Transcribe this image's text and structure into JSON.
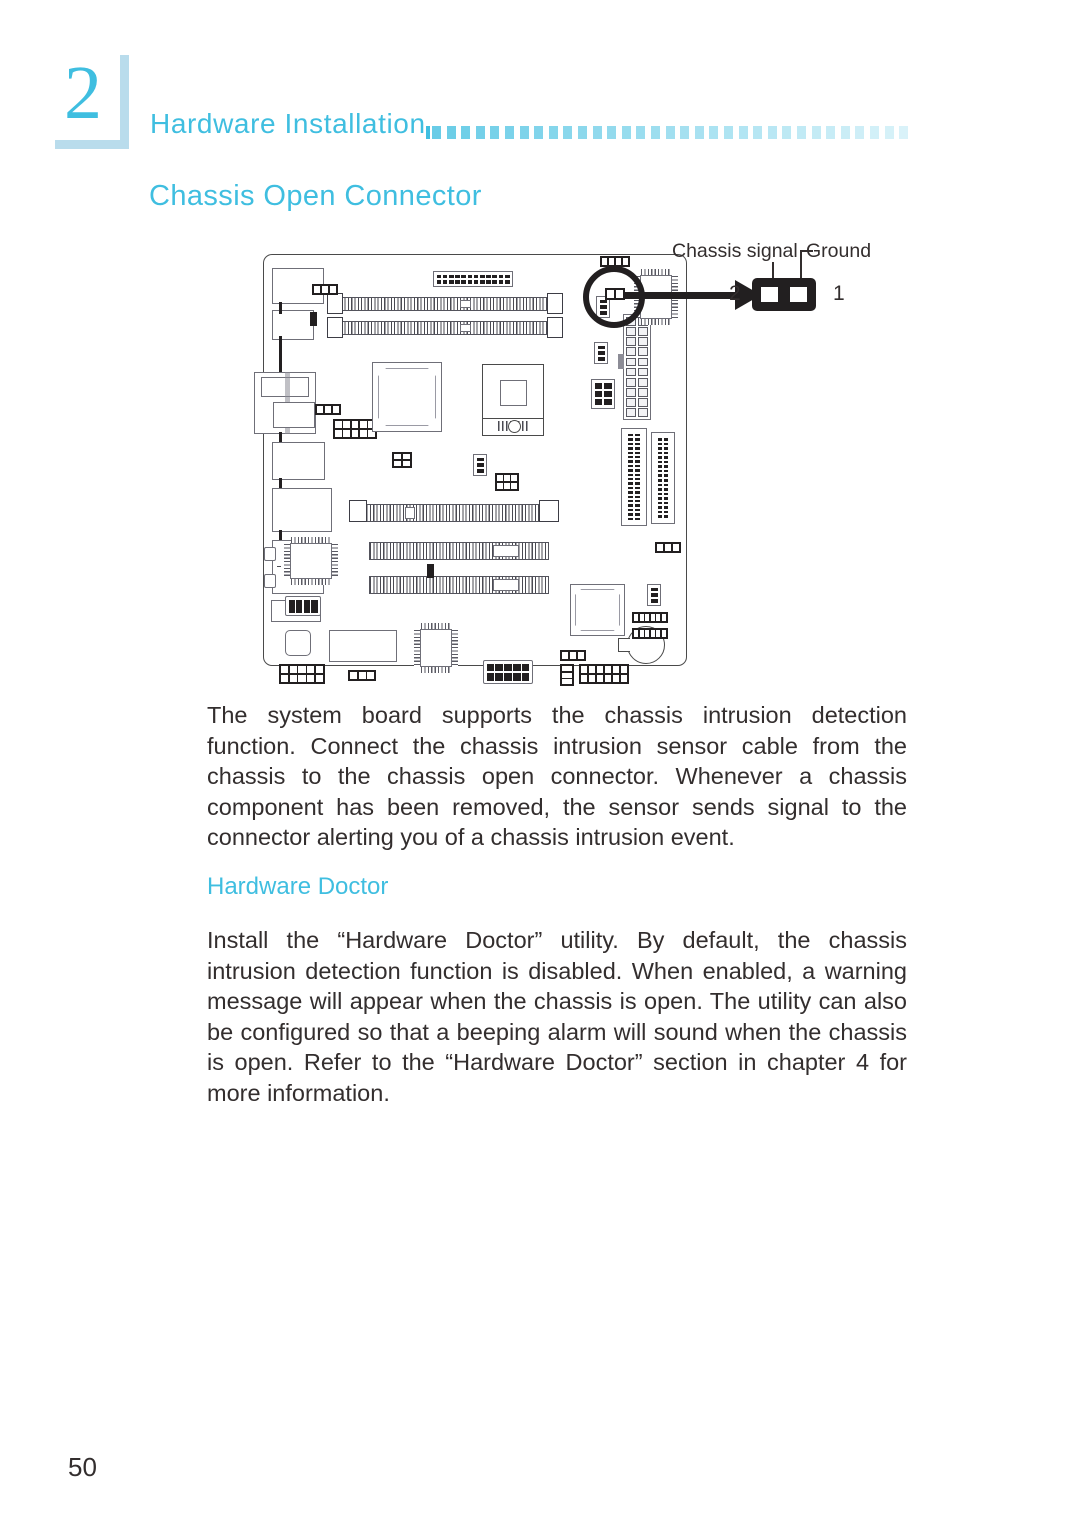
{
  "chapter": {
    "number": "2",
    "running_head": "Hardware  Installation",
    "accent_color": "#3fbee0",
    "shadow_color": "#b9dcec"
  },
  "section": {
    "title": "Chassis Open Connector"
  },
  "figure": {
    "labels": {
      "chassis_signal": "Chassis  signal",
      "ground": "Ground",
      "pin_left": "2",
      "pin_right": "1"
    },
    "caption": "",
    "board_description": "system board layout diagram with chassis open connector highlighted"
  },
  "body": {
    "paragraph_1": "The system board supports the chassis intrusion detection function. Connect the chassis intrusion sensor cable from the chassis to the chassis open connector. Whenever a chassis component has been removed, the sensor sends signal to the connector alerting you of a chassis intrusion event.",
    "subsection_title": "Hardware Doctor",
    "paragraph_2": "Install the “Hardware Doctor” utility. By default, the chassis intrusion detection function is disabled. When enabled, a warning message will appear when the chassis is open. The utility can also be configured so that a beeping alarm will sound when the chassis is open. Refer to the “Hardware Doctor” section in chapter 4 for more information."
  },
  "footer": {
    "page_number": "50"
  }
}
